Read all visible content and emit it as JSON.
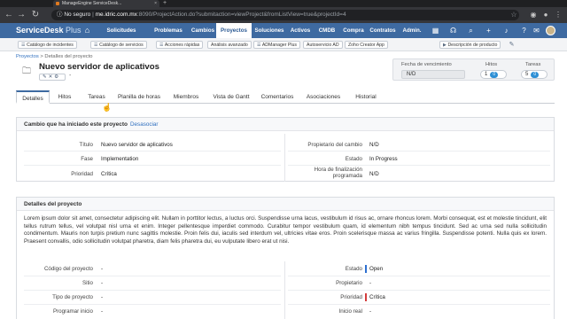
{
  "browser": {
    "tab_title": "ManageEngine ServiceDesk...",
    "tab_close": "×",
    "new_tab": "+",
    "insecure_label": "No seguro",
    "url_sep": " | ",
    "url_host": "me.idric.com.mx",
    "url_path": ":8090/ProjectAction.do?submitaction=viewProject&fromListView=true&projectId=4",
    "icons": [
      "back-icon",
      "forward-icon",
      "reload-icon",
      "star-icon",
      "extension-icon",
      "profile-icon",
      "menu-icon"
    ]
  },
  "app": {
    "brand_name": "ServiceDesk",
    "brand_plus": " Plus",
    "nav": [
      {
        "label": "Solicitudes"
      },
      {
        "label": "Problemas"
      },
      {
        "label": "Cambios"
      },
      {
        "label": "Proyectos",
        "active": true
      },
      {
        "label": "Soluciones"
      },
      {
        "label": "Activos"
      },
      {
        "label": "CMDB"
      },
      {
        "label": "Compra"
      },
      {
        "label": "Contratos"
      },
      {
        "label": "Admin."
      }
    ],
    "accent_color": "#3e6aa1"
  },
  "quickbar": {
    "items": [
      "Catálogo de incidentes",
      "Catálogo de servicios",
      "Acciones rápidas",
      "Análisis avanzado",
      "ADManager Plus",
      "Autoservicio AD",
      "Zoho Creator App",
      "Descripción de producto"
    ]
  },
  "breadcrumb": {
    "root": "Proyectos",
    "sep": " > ",
    "current": "Detalles del proyecto"
  },
  "project": {
    "title": "Nuevo servidor de aplicativos",
    "mini_actions": "✎✕⚙",
    "dash": "-"
  },
  "summary": {
    "due_label": "Fecha de vencimiento",
    "due_value": "N/D",
    "milestones_label": "Hitos",
    "milestones_value": "1",
    "milestones_badge": "0",
    "tasks_label": "Tareas",
    "tasks_value": "5",
    "tasks_badge": "0"
  },
  "tabs": [
    {
      "label": "Detalles",
      "active": true
    },
    {
      "label": "Hitos"
    },
    {
      "label": "Tareas"
    },
    {
      "label": "Planilla de horas"
    },
    {
      "label": "Miembros"
    },
    {
      "label": "Vista de Gantt"
    },
    {
      "label": "Comentarios"
    },
    {
      "label": "Asociaciones"
    },
    {
      "label": "Historial"
    }
  ],
  "change_panel": {
    "title": "Cambio que ha iniciado este proyecto",
    "link": "Desasociar",
    "left": [
      {
        "label": "Título",
        "value": "Nuevo servidor de aplicativos"
      },
      {
        "label": "Fase",
        "value": "Implementation"
      },
      {
        "label": "Prioridad",
        "value": "Crítica"
      }
    ],
    "right": [
      {
        "label": "Propietario del cambio",
        "value": "N/D"
      },
      {
        "label": "Estado",
        "value": "In Progress"
      },
      {
        "label": "Hora de finalización programada",
        "value": "N/D"
      }
    ]
  },
  "details_panel": {
    "title": "Detalles del proyecto",
    "description": "Lorem ipsum dolor sit amet, consectetur adipiscing elit. Nullam in porttitor lectus, a luctus orci. Suspendisse urna lacus, vestibulum id risus ac, ornare rhoncus lorem. Morbi consequat, est et molestie tincidunt, elit tellus rutrum tellus, vel volutpat nisl urna et enim. Integer pellentesque imperdiet commodo. Curabitur tempor vestibulum quam, id elementum nibh tempus tincidunt. Sed ac urna sed nulla sollicitudin condimentum. Mauris non turpis pretium nunc sagittis molestie. Proin felis dui, iaculis sed interdum vel, ultricies vitae eros. Proin scelerisque massa ac varius fringilla. Suspendisse potenti. Nulla quis ex lorem. Praesent convallis, odio sollicitudin volutpat pharetra, diam felis pharetra dui, eu vulputate libero erat ut nisi.",
    "left": [
      {
        "label": "Código del proyecto",
        "value": "-"
      },
      {
        "label": "Sitio",
        "value": "-"
      },
      {
        "label": "Tipo de proyecto",
        "value": "-"
      },
      {
        "label": "Programar inicio",
        "value": "-"
      }
    ],
    "right": [
      {
        "label": "Estado",
        "value": "Open",
        "color": "#2d6fd0"
      },
      {
        "label": "Propietario",
        "value": "-"
      },
      {
        "label": "Prioridad",
        "value": "Crítica",
        "color": "#d43c3c"
      },
      {
        "label": "Inicio real",
        "value": "-"
      }
    ]
  }
}
